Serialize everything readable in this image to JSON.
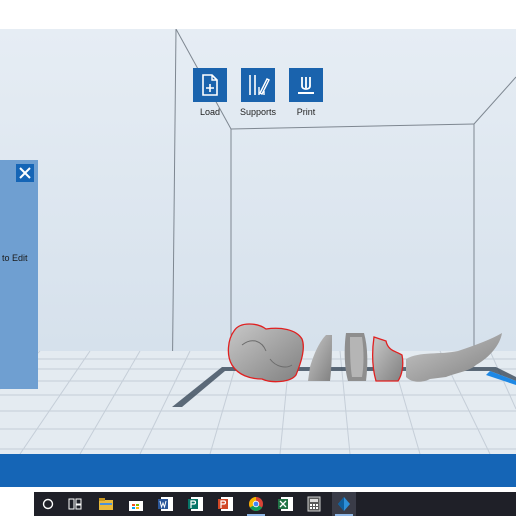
{
  "toolbar": {
    "load_label": "Load",
    "supports_label": "Supports",
    "print_label": "Print"
  },
  "side_panel": {
    "text": "to Edit"
  },
  "taskbar": {
    "items": [
      "cortana-icon",
      "task-view-icon",
      "file-explorer-icon",
      "store-icon",
      "word-icon",
      "publisher-icon",
      "powerpoint-icon",
      "chrome-icon",
      "excel-icon",
      "calculator-icon",
      "slicer-app-icon"
    ]
  },
  "colors": {
    "accent": "#1565b6",
    "panel": "#6f9fd1",
    "selection_outline": "#e02020",
    "model": "#9a9a9a"
  }
}
